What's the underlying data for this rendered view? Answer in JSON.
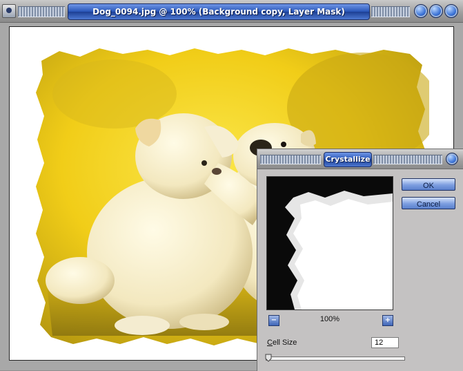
{
  "document_window": {
    "title": "Dog_0094.jpg @ 100% (Background copy, Layer Mask)",
    "icons": [
      "app-icon",
      "minimize-icon",
      "maximize-icon",
      "close-icon"
    ]
  },
  "dialog": {
    "title": "Crystallize",
    "ok_label": "OK",
    "cancel_label": "Cancel",
    "zoom_out_glyph": "−",
    "zoom_in_glyph": "+",
    "zoom_level": "100%",
    "cell_size_mnemonic": "C",
    "cell_size_label_rest": "ell Size",
    "cell_size_value": "12",
    "cell_size_slider_fraction": 0.02
  },
  "colors": {
    "title_pill_blue": "#2855b8",
    "photo_yellow": "#f2d420",
    "dialog_gray": "#c4c2c2"
  }
}
